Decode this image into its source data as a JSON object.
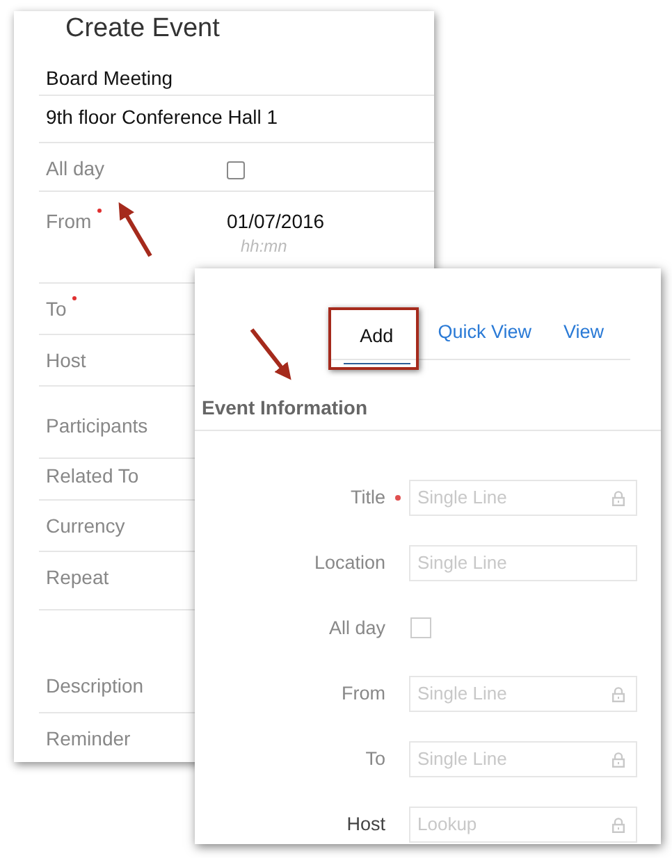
{
  "create_event": {
    "title": "Create Event",
    "rows": [
      {
        "kind": "value",
        "value": "Board Meeting"
      },
      {
        "kind": "value",
        "value": "9th floor Conference Hall 1"
      },
      {
        "kind": "checkbox",
        "label": "All day",
        "checked": false
      },
      {
        "kind": "datetime",
        "label": "From",
        "required": true,
        "value": "01/07/2016",
        "placeholder": "hh:mn"
      },
      {
        "kind": "label",
        "label": "To",
        "required": true
      },
      {
        "kind": "label",
        "label": "Host",
        "required": false
      },
      {
        "kind": "label",
        "label": "Participants",
        "required": false
      },
      {
        "kind": "label",
        "label": "Related To",
        "required": false
      },
      {
        "kind": "label",
        "label": "Currency",
        "required": false
      },
      {
        "kind": "label",
        "label": "Repeat",
        "required": false
      },
      {
        "kind": "tall",
        "label": "Description",
        "required": false
      },
      {
        "kind": "label",
        "label": "Reminder",
        "required": false
      }
    ]
  },
  "layout_editor": {
    "tabs": [
      {
        "label": "Add",
        "selected": true
      },
      {
        "label": "Quick View",
        "selected": false
      },
      {
        "label": "View",
        "selected": false
      }
    ],
    "section": "Event Information",
    "fields": [
      {
        "kind": "text",
        "label": "Title",
        "required": true,
        "placeholder": "Single Line",
        "locked": true
      },
      {
        "kind": "text",
        "label": "Location",
        "required": false,
        "placeholder": "Single Line",
        "locked": false
      },
      {
        "kind": "checkbox",
        "label": "All day",
        "checked": false
      },
      {
        "kind": "text",
        "label": "From",
        "required": false,
        "placeholder": "Single Line",
        "locked": true
      },
      {
        "kind": "text",
        "label": "To",
        "required": false,
        "placeholder": "Single Line",
        "locked": true
      },
      {
        "kind": "text",
        "label": "Host",
        "required": false,
        "placeholder": "Lookup",
        "locked": true,
        "emphasis": true
      }
    ]
  }
}
